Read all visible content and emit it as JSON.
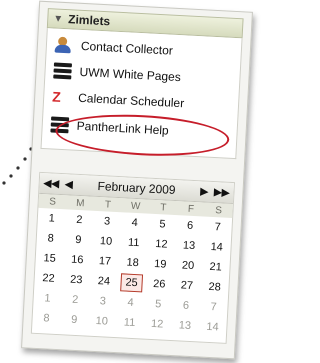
{
  "zimlets": {
    "title": "Zimlets",
    "items": [
      {
        "label": "Contact Collector",
        "icon": "contact-collector-icon"
      },
      {
        "label": "UWM White Pages",
        "icon": "stack-icon"
      },
      {
        "label": "Calendar Scheduler",
        "icon": "calendar-scheduler-icon"
      },
      {
        "label": "PantherLink Help",
        "icon": "stack-icon"
      }
    ]
  },
  "calendar": {
    "month_label": "February 2009",
    "nav": {
      "prev_year": "◀◀",
      "prev_month": "◀",
      "next_month": "▶",
      "next_year": "▶▶"
    },
    "weekdays": [
      "S",
      "M",
      "T",
      "W",
      "T",
      "F",
      "S"
    ],
    "weeks": [
      [
        "1",
        "2",
        "3",
        "4",
        "5",
        "6",
        "7"
      ],
      [
        "8",
        "9",
        "10",
        "11",
        "12",
        "13",
        "14"
      ],
      [
        "15",
        "16",
        "17",
        "18",
        "19",
        "20",
        "21"
      ],
      [
        "22",
        "23",
        "24",
        "25",
        "26",
        "27",
        "28"
      ],
      [
        "1",
        "2",
        "3",
        "4",
        "5",
        "6",
        "7"
      ],
      [
        "8",
        "9",
        "10",
        "11",
        "12",
        "13",
        "14"
      ]
    ],
    "today": "25"
  },
  "colors": {
    "highlight_ring": "#c61d2a",
    "today_border": "#b43a2a",
    "header_bg": "#dfe3c8"
  }
}
